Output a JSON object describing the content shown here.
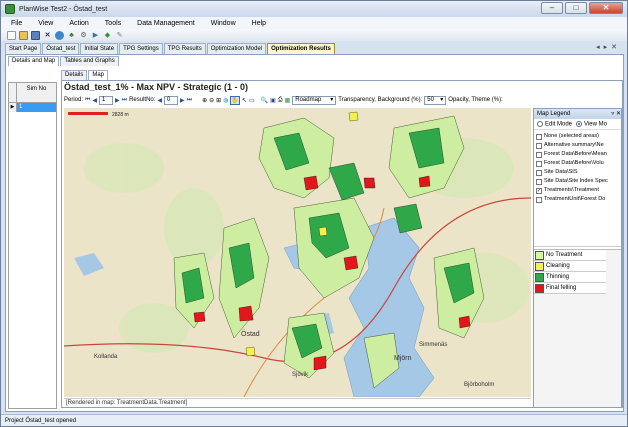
{
  "window": {
    "title": "PlanWise Test2 - Östad_test"
  },
  "menu": [
    "File",
    "View",
    "Action",
    "Tools",
    "Data Management",
    "Window",
    "Help"
  ],
  "doc_tabs": [
    "Start Page",
    "Östad_test",
    "Initial State",
    "TPG Settings",
    "TPG Results",
    "Optimization Model",
    "Optimization Results"
  ],
  "sub_tabs": [
    "Details and Map",
    "Tables and Graphs"
  ],
  "sim_table": {
    "header": "Sim No",
    "row_value": "1"
  },
  "map_tabs": [
    "Details",
    "Map"
  ],
  "map": {
    "title": "Östad_test_1% - Max NPV - Strategic (1 - 0)",
    "period_label": "Period:",
    "period_value": "1",
    "result_label": "ResultNo:",
    "result_value": "0",
    "basemap": "Roadmap",
    "transparency_label": "Transparency, Background (%):",
    "transparency_value": "50",
    "opacity_label": "Opacity, Theme (%):",
    "scale_text": "2828 m",
    "status": "[Rendered in map: TreatmentData.Treatment]",
    "place_labels": [
      "Östad",
      "Mjörn",
      "Sjövik",
      "Simmenäs",
      "Björboholm",
      "Kollanda"
    ]
  },
  "legend": {
    "title": "Map Legend",
    "edit_mode": "Edit Mode",
    "view_mode": "View Mo",
    "layers": [
      {
        "label": "None (selected areas)",
        "checked": false
      },
      {
        "label": "Alternative summary\\Ne",
        "checked": false
      },
      {
        "label": "Forest Data\\Before\\Mean",
        "checked": false
      },
      {
        "label": "Forest Data\\Before\\Volu",
        "checked": false
      },
      {
        "label": "Site Data\\SIS",
        "checked": false
      },
      {
        "label": "Site Data\\Site Index Spec",
        "checked": false
      },
      {
        "label": "Treatments\\Treatment",
        "checked": true
      },
      {
        "label": "TreatmentUnit\\Forest Do",
        "checked": false
      }
    ],
    "items": [
      {
        "label": "No Treatment",
        "color": "#d8f5a5"
      },
      {
        "label": "Cleaning",
        "color": "#f5f04a"
      },
      {
        "label": "Thinning",
        "color": "#2fa84a"
      },
      {
        "label": "Final felling",
        "color": "#e3171b"
      }
    ]
  },
  "statusbar": "Project Östad_test opened"
}
